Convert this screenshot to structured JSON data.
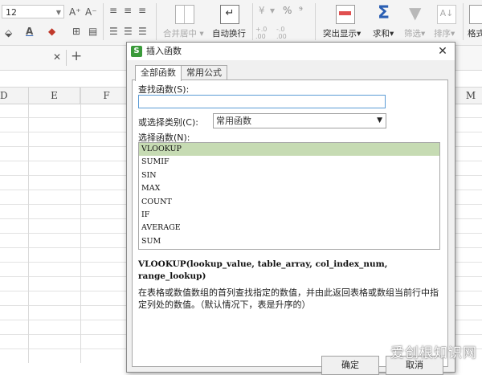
{
  "ribbon": {
    "font_size": "12",
    "font_grow_icon": "A⁺",
    "font_shrink_icon": "A⁻",
    "merge_center_label": "合并居中",
    "merge_center_arrow": "▾",
    "wrap_text_label": "自动换行",
    "percent_symbol": "%",
    "number_format_arrow": "▾",
    "decimal_increase": "+.0 .00",
    "decimal_decrease": "-.0 .00",
    "highlight_label": "突出显示",
    "highlight_arrow": "▾",
    "sum_label": "求和",
    "sum_arrow": "▾",
    "filter_label": "筛选",
    "filter_arrow": "▾",
    "sort_label": "排序",
    "sort_arrow": "▾",
    "format_label": "格式"
  },
  "tabbar": {
    "close_symbol": "✕",
    "add_symbol": "+"
  },
  "columns": [
    "D",
    "E",
    "F",
    "M"
  ],
  "dialog": {
    "title": "插入函数",
    "app_icon": "S",
    "close_symbol": "✕",
    "tabs": [
      "全部函数",
      "常用公式"
    ],
    "search_label": "查找函数(S):",
    "search_value": "",
    "category_label": "或选择类别(C):",
    "category_value": "常用函数",
    "category_arrow": "▼",
    "function_label": "选择函数(N):",
    "functions": [
      "VLOOKUP",
      "SUMIF",
      "SIN",
      "MAX",
      "COUNT",
      "IF",
      "AVERAGE",
      "SUM"
    ],
    "selected_function": "VLOOKUP",
    "signature": "VLOOKUP(lookup_value, table_array, col_index_num, range_lookup)",
    "description": "在表格或数值数组的首列查找指定的数值，并由此返回表格或数组当前行中指定列处的数值。（默认情况下，表是升序的）",
    "ok_label": "确定",
    "cancel_label": "取消"
  },
  "watermark": "爱创根知识网",
  "colors": {
    "accent_green": "#3a9a3a",
    "selection": "#c6dbb3",
    "focus_border": "#5b9bd5"
  }
}
